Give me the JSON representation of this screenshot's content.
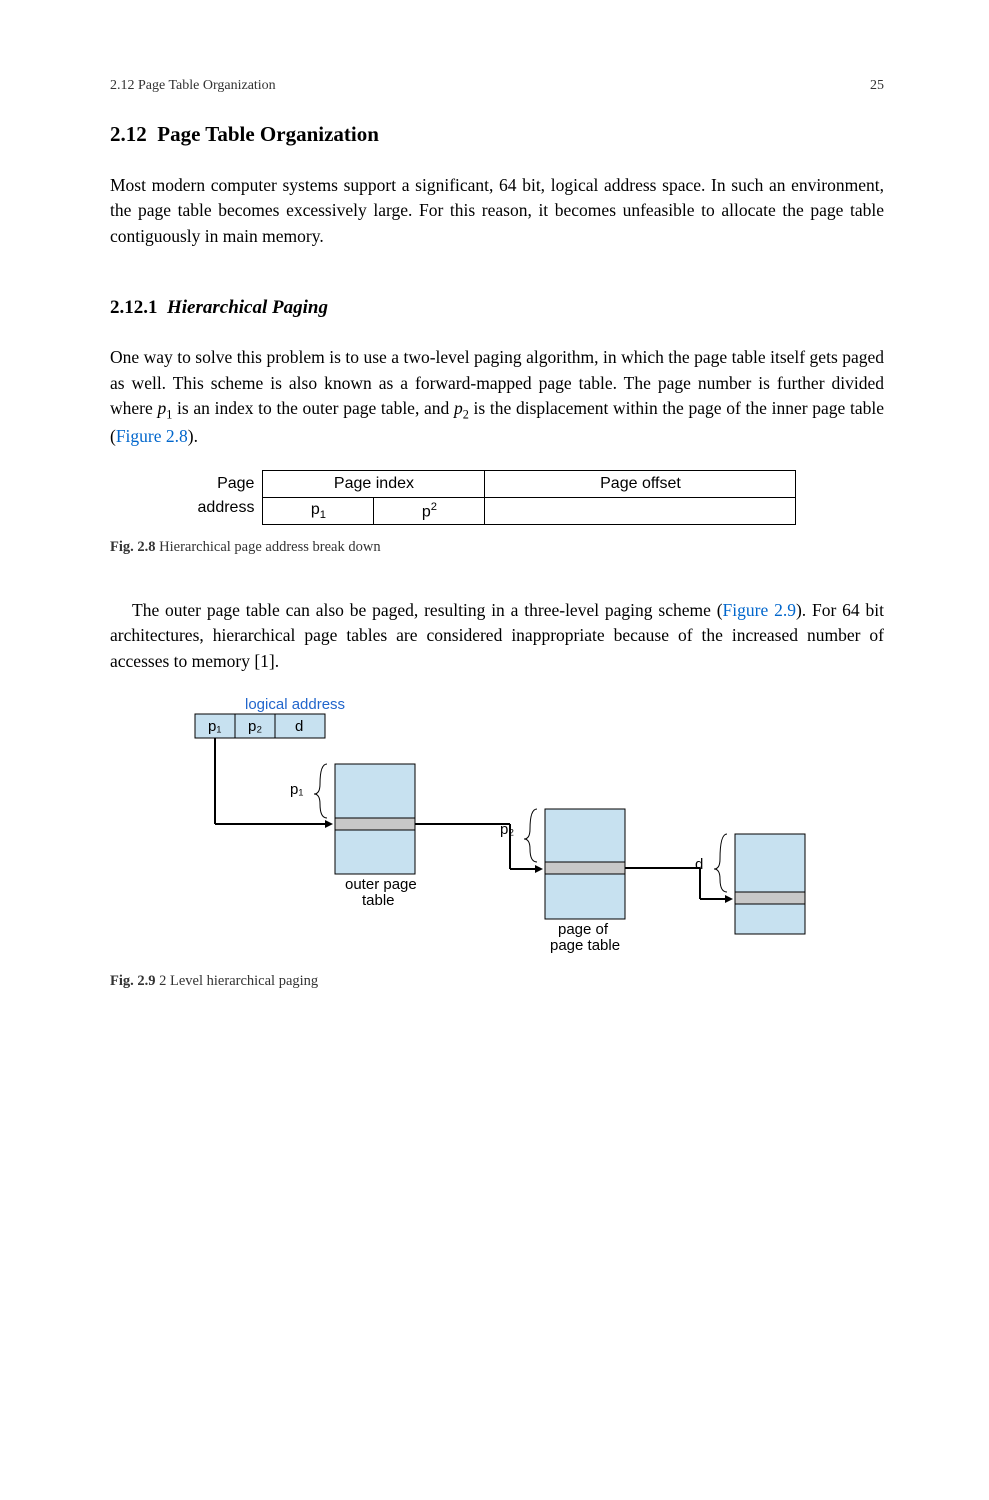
{
  "header": {
    "left": "2.12  Page Table Organization",
    "right": "25"
  },
  "section": {
    "number": "2.12",
    "title": "Page Table Organization"
  },
  "para1": "Most modern computer systems support a significant, 64 bit, logical address space. In such an environment, the page table becomes excessively large. For this reason, it becomes unfeasible to allocate the page table contiguously in main memory.",
  "subsection": {
    "number": "2.12.1",
    "title": "Hierarchical Paging"
  },
  "para2_part1": "One way to solve this problem is to use a two-level paging algorithm, in which the page table itself gets paged as well. This scheme is also known as a forward-mapped page table. The page number is further divided where ",
  "para2_part2": " is an index to the outer page table, and ",
  "para2_part3": " is the displacement within the page of the inner page table (",
  "para2_link": "Figure 2.8",
  "para2_part4": ").",
  "p1_var": "p",
  "p1_sub": "1",
  "p2_var": "p",
  "p2_sub": "2",
  "fig28": {
    "label_line1": "Page",
    "label_line2": "address",
    "header_index": "Page index",
    "header_offset": "Page offset",
    "cell_p1": "p",
    "cell_p1_sub": "1",
    "cell_p2": "p",
    "cell_p2_sup": "2"
  },
  "caption28_bold": "Fig. 2.8",
  "caption28_text": "  Hierarchical page address break down",
  "para3_part1": "The outer page table can also be paged, resulting in a three-level paging scheme (",
  "para3_link": "Figure 2.9",
  "para3_part2": "). For 64 bit architectures, hierarchical page tables are considered inappropriate because of the increased number of accesses to memory [1].",
  "fig29": {
    "logical_address": "logical address",
    "p1": "p₁",
    "p2": "p₂",
    "d": "d",
    "p1_label": "p₁",
    "p2_label": "p₂",
    "d_label": "d",
    "outer_table": "outer page\ntable",
    "page_of": "page of\npage table"
  },
  "caption29_bold": "Fig. 2.9",
  "caption29_text": "  2 Level hierarchical paging"
}
